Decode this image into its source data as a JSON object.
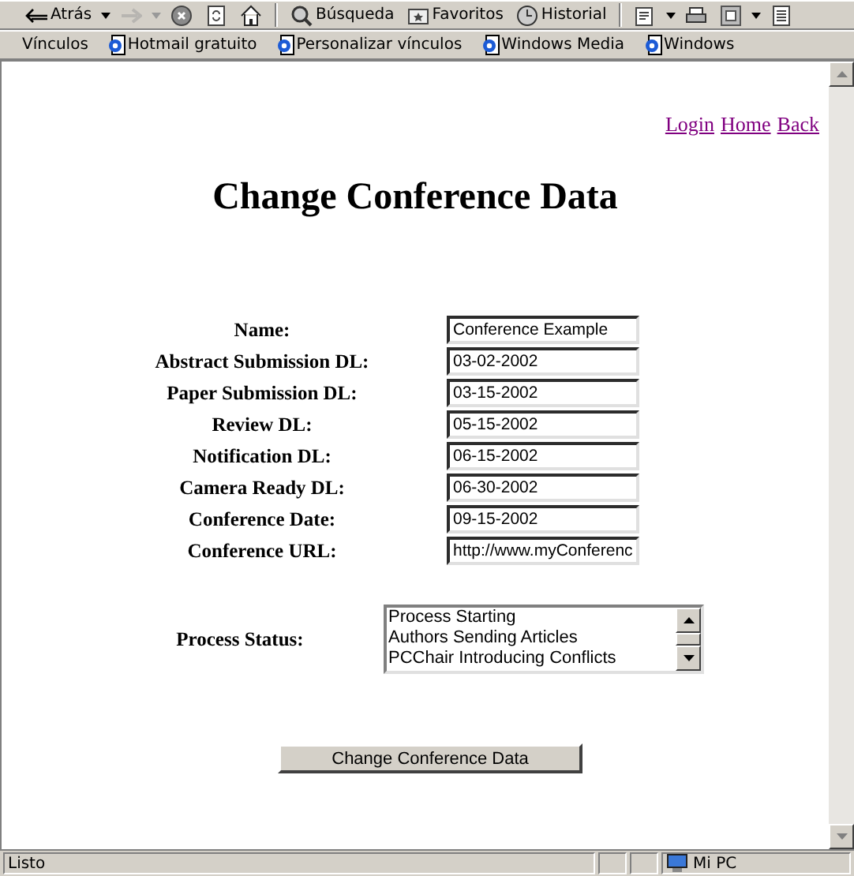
{
  "toolbar": [
    {
      "kind": "back",
      "label": "Atrás",
      "disabled": false
    },
    {
      "kind": "forward",
      "disabled": true
    },
    {
      "kind": "stop",
      "disabled": false
    },
    {
      "kind": "refresh",
      "disabled": false
    },
    {
      "kind": "home",
      "disabled": false
    },
    {
      "kind": "search",
      "label": "Búsqueda",
      "disabled": false
    },
    {
      "kind": "favorites",
      "label": "Favoritos",
      "disabled": false
    },
    {
      "kind": "history",
      "label": "Historial",
      "disabled": false
    },
    {
      "kind": "mail",
      "disabled": false
    },
    {
      "kind": "print",
      "disabled": false
    },
    {
      "kind": "edit",
      "disabled": false
    },
    {
      "kind": "discuss",
      "disabled": false
    }
  ],
  "links_bar": {
    "title": "Vínculos",
    "links": [
      "Hotmail gratuito",
      "Personalizar vínculos",
      "Windows Media",
      "Windows"
    ]
  },
  "page": {
    "nav_links": [
      "Login",
      "Home",
      "Back"
    ],
    "heading": "Change Conference Data",
    "fields": [
      {
        "label": "Name:",
        "value": "Conference Example"
      },
      {
        "label": "Abstract Submission DL:",
        "value": "03-02-2002"
      },
      {
        "label": "Paper Submission DL:",
        "value": "03-15-2002"
      },
      {
        "label": "Review DL:",
        "value": "05-15-2002"
      },
      {
        "label": "Notification DL:",
        "value": "06-15-2002"
      },
      {
        "label": "Camera Ready DL:",
        "value": "06-30-2002"
      },
      {
        "label": "Conference Date:",
        "value": "09-15-2002"
      },
      {
        "label": "Conference URL:",
        "value": "http://www.myConferenc"
      }
    ],
    "process_status": {
      "label": "Process Status:",
      "options": [
        {
          "text": "Process Starting",
          "selected": false
        },
        {
          "text": "Authors Sending Articles",
          "selected": false
        },
        {
          "text": "PCChair Introducing Conflicts",
          "selected": false
        }
      ]
    },
    "submit": "Change Conference Data"
  },
  "status_bar": {
    "text": "Listo",
    "zone": "Mi PC"
  }
}
